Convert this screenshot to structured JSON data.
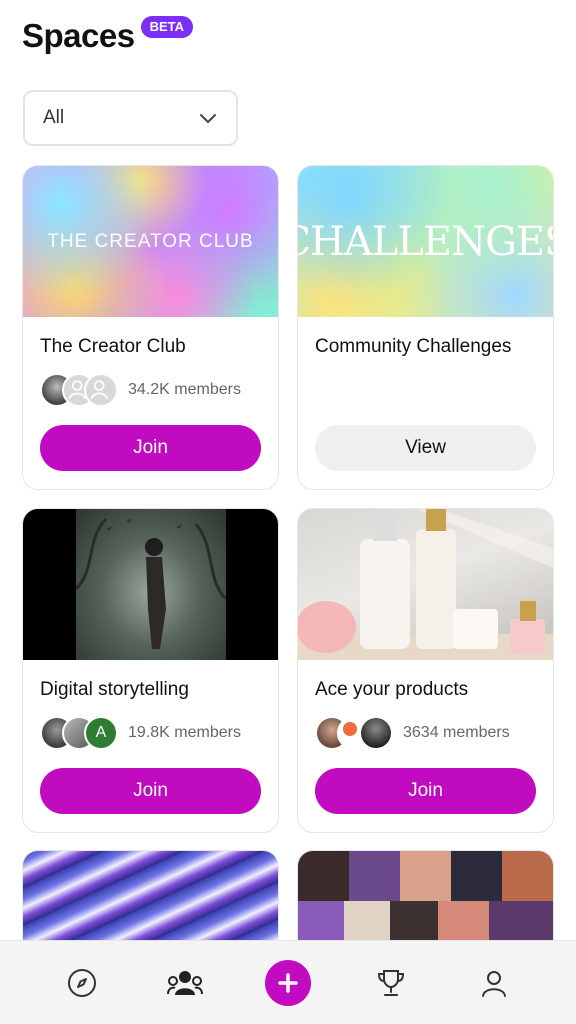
{
  "header": {
    "title": "Spaces",
    "badge": "BETA"
  },
  "filter": {
    "value": "All"
  },
  "cards": [
    {
      "title": "The Creator Club",
      "cover_text": "THE CREATOR CLUB",
      "members": "34.2K members",
      "button": "Join"
    },
    {
      "title": "Community Challenges",
      "cover_text": "CHALLENGES",
      "members": "",
      "button": "View"
    },
    {
      "title": "Digital storytelling",
      "members": "19.8K members",
      "button": "Join",
      "avatar_letter": "A"
    },
    {
      "title": "Ace your products",
      "members": "3634 members",
      "button": "Join"
    }
  ],
  "nav": {
    "items": [
      "compass-icon",
      "community-icon",
      "plus-icon",
      "trophy-icon",
      "profile-icon"
    ]
  },
  "colors": {
    "accent": "#c10bc1",
    "beta": "#7b2ff7"
  }
}
